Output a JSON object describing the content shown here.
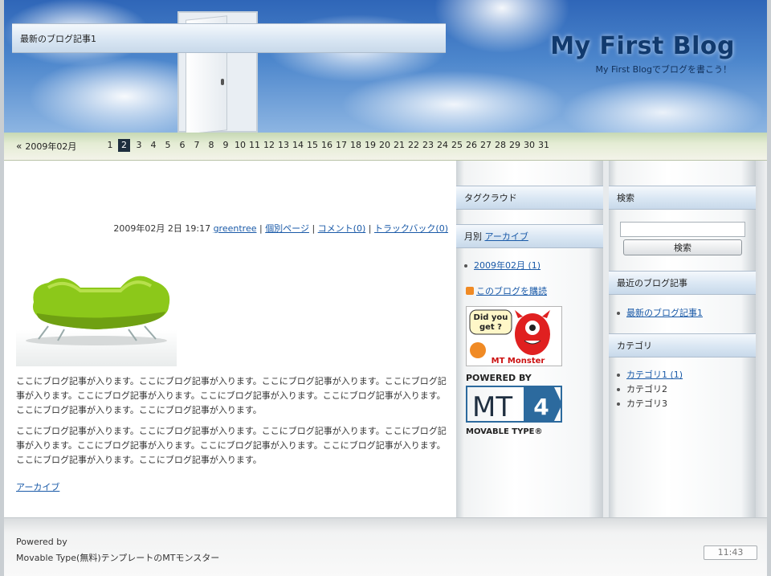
{
  "header": {
    "title": "My First Blog",
    "subtitle": "My First Blogでブログを書こう！"
  },
  "calendar": {
    "prev_month_label": "2009年02月",
    "days": [
      "1",
      "2",
      "3",
      "4",
      "5",
      "6",
      "7",
      "8",
      "9",
      "10",
      "11",
      "12",
      "13",
      "14",
      "15",
      "16",
      "17",
      "18",
      "19",
      "20",
      "21",
      "22",
      "23",
      "24",
      "25",
      "26",
      "27",
      "28",
      "29",
      "30",
      "31"
    ],
    "active_day": "2"
  },
  "entry": {
    "title": "最新のブログ記事1",
    "date": "2009年02月 2日 19:17",
    "author": "greentree",
    "permalink_label": "個別ページ",
    "comments_label": "コメント(0)",
    "trackbacks_label": "トラックバック(0)",
    "paragraphs": [
      "ここにブログ記事が入ります。ここにブログ記事が入ります。ここにブログ記事が入ります。ここにブログ記事が入ります。ここにブログ記事が入ります。ここにブログ記事が入ります。ここにブログ記事が入ります。ここにブログ記事が入ります。ここにブログ記事が入ります。",
      "ここにブログ記事が入ります。ここにブログ記事が入ります。ここにブログ記事が入ります。ここにブログ記事が入ります。ここにブログ記事が入ります。ここにブログ記事が入ります。ここにブログ記事が入ります。ここにブログ記事が入ります。ここにブログ記事が入ります。"
    ],
    "archive_link": "アーカイブ"
  },
  "sidebar_mid": {
    "tagcloud_heading": "タグクラウド",
    "monthly_heading_prefix": "月別 ",
    "monthly_heading_link": "アーカイブ",
    "monthly_items": [
      "2009年02月 (1)"
    ],
    "feed_link": "このブログを購読",
    "monster_badge": {
      "line1": "Did you",
      "line2": "get ?",
      "caption": "MT Monster"
    },
    "powered_badge": {
      "top": "POWERED BY",
      "mark": "MT",
      "version": "4",
      "bottom": "MOVABLE TYPE®"
    }
  },
  "sidebar_right": {
    "search_heading": "検索",
    "search_value": "",
    "search_button": "検索",
    "recent_heading": "最近のブログ記事",
    "recent_items": [
      "最新のブログ記事1"
    ],
    "category_heading": "カテゴリ",
    "categories": [
      {
        "label": "カテゴリ1 (1)",
        "link": true
      },
      {
        "label": "カテゴリ2",
        "link": false
      },
      {
        "label": "カテゴリ3",
        "link": false
      }
    ]
  },
  "footer": {
    "powered": "Powered by",
    "credit": "Movable Type(無料)テンプレートのMTモンスター",
    "clock": "11:43"
  },
  "colors": {
    "title": "#113a6e",
    "link": "#1a5aa8",
    "sofa": "#8cc81a",
    "monster": "#e02020",
    "mt_blue": "#2c6a9e"
  }
}
